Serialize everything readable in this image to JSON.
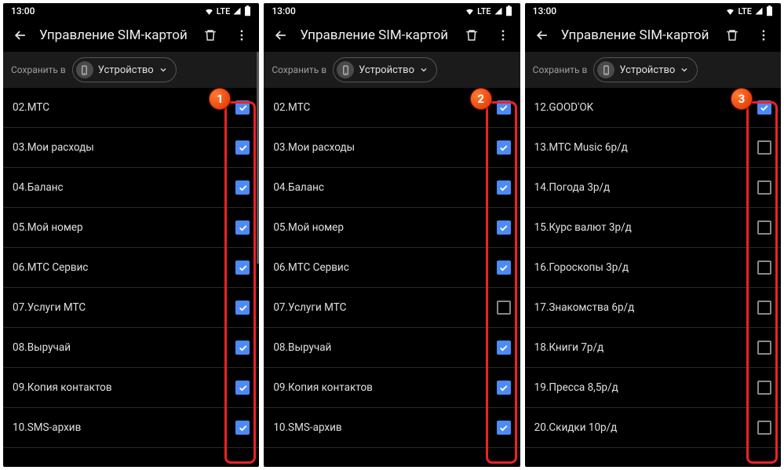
{
  "status": {
    "time": "13:00",
    "net": "LTE"
  },
  "header": {
    "title": "Управление SIM-картой"
  },
  "save": {
    "label": "Сохранить в",
    "target": "Устройство"
  },
  "panels": [
    {
      "badge": "1",
      "items": [
        {
          "label": "02.МТС",
          "checked": true
        },
        {
          "label": "03.Мои расходы",
          "checked": true
        },
        {
          "label": "04.Баланс",
          "checked": true
        },
        {
          "label": "05.Мой номер",
          "checked": true
        },
        {
          "label": "06.МТС Сервис",
          "checked": true
        },
        {
          "label": "07.Услуги МТС",
          "checked": true
        },
        {
          "label": "08.Выручай",
          "checked": true
        },
        {
          "label": "09.Копия контактов",
          "checked": true
        },
        {
          "label": "10.SMS-архив",
          "checked": true
        }
      ]
    },
    {
      "badge": "2",
      "items": [
        {
          "label": "02.МТС",
          "checked": true
        },
        {
          "label": "03.Мои расходы",
          "checked": true
        },
        {
          "label": "04.Баланс",
          "checked": true
        },
        {
          "label": "05.Мой номер",
          "checked": true
        },
        {
          "label": "06.МТС Сервис",
          "checked": true
        },
        {
          "label": "07.Услуги МТС",
          "checked": false
        },
        {
          "label": "08.Выручай",
          "checked": true
        },
        {
          "label": "09.Копия контактов",
          "checked": true
        },
        {
          "label": "10.SMS-архив",
          "checked": true
        }
      ]
    },
    {
      "badge": "3",
      "items": [
        {
          "label": "12.GOOD'OK",
          "checked": true
        },
        {
          "label": "13.МТС Music 6р/д",
          "checked": false
        },
        {
          "label": "14.Погода 3р/д",
          "checked": false
        },
        {
          "label": "15.Курс валют 3р/д",
          "checked": false
        },
        {
          "label": "16.Гороскопы 3р/д",
          "checked": false
        },
        {
          "label": "17.Знакомства 6р/д",
          "checked": false
        },
        {
          "label": "18.Книги 7р/д",
          "checked": false
        },
        {
          "label": "19.Пресса 8,5р/д",
          "checked": false
        },
        {
          "label": "20.Скидки 10р/д",
          "checked": false
        }
      ]
    }
  ]
}
